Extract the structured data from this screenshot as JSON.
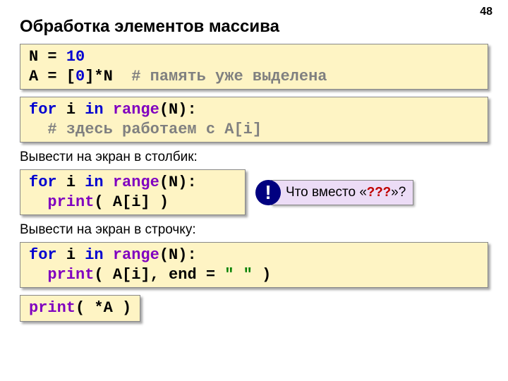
{
  "page_number": "48",
  "title": "Обработка элементов массива",
  "code1": {
    "line1_a": "N = ",
    "line1_b": "10",
    "line2_a": "A = [",
    "line2_b": "0",
    "line2_c": "]*N  ",
    "line2_d": "# память уже выделена"
  },
  "code2": {
    "line1_a": "for ",
    "line1_b": "i ",
    "line1_c": "in ",
    "line1_d": "range",
    "line1_e": "(N):",
    "line2": "  # здесь работаем с A[i]"
  },
  "subtitle1": "Вывести на экран в столбик:",
  "code3": {
    "line1_a": "for ",
    "line1_b": "i ",
    "line1_c": "in ",
    "line1_d": "range",
    "line1_e": "(N):",
    "line2_a": "  print",
    "line2_b": "( A[i] )"
  },
  "callout": {
    "mark": "!",
    "text_a": "Что вместо «",
    "text_b": "???",
    "text_c": "»?"
  },
  "subtitle2": "Вывести на экран в строчку:",
  "code4": {
    "line1_a": "for ",
    "line1_b": "i ",
    "line1_c": "in ",
    "line1_d": "range",
    "line1_e": "(N):",
    "line2_a": "  print",
    "line2_b": "( A[i], end = ",
    "line2_c": "\" \"",
    "line2_d": " )"
  },
  "code5": {
    "a": "print",
    "b": "( *A )"
  }
}
